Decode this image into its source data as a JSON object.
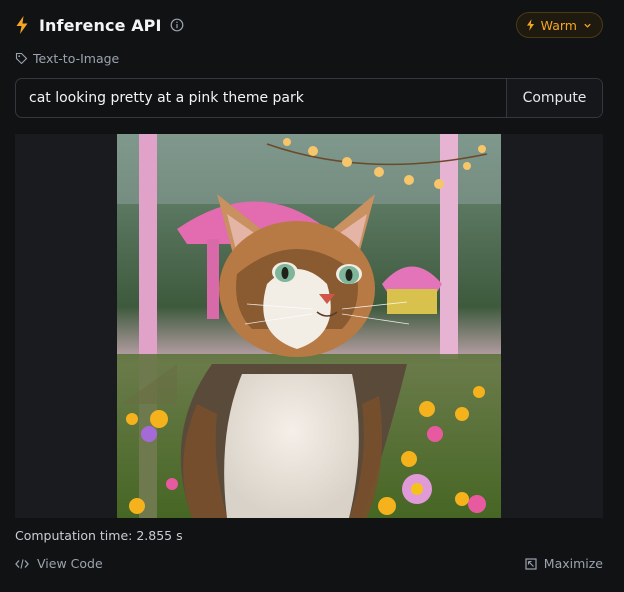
{
  "header": {
    "title": "Inference API",
    "status_label": "Warm",
    "accent_color": "#f5a524"
  },
  "task": {
    "label": "Text-to-Image"
  },
  "prompt": {
    "value": "cat looking pretty at a pink theme park",
    "compute_label": "Compute"
  },
  "result": {
    "computation_time": "Computation time: 2.855 s"
  },
  "footer": {
    "view_code_label": "View Code",
    "maximize_label": "Maximize"
  },
  "icons": {
    "header": "lightning-bolt-icon",
    "info": "info-circle-icon",
    "status": "lightning-bolt-icon",
    "status_menu": "chevron-down-icon",
    "task": "tag-icon",
    "code": "code-brackets-icon",
    "maximize": "maximize-icon"
  }
}
